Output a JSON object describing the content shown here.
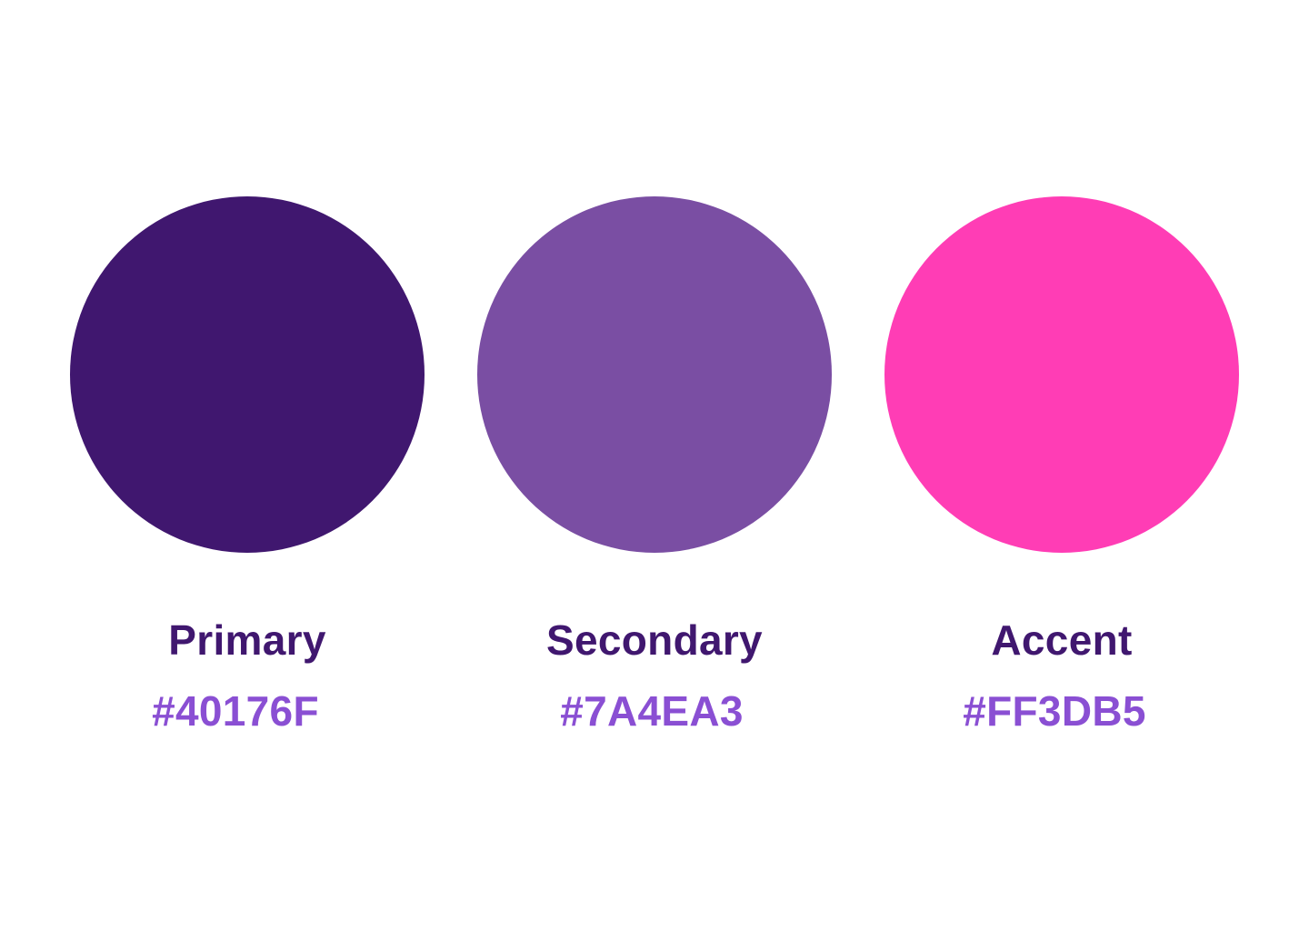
{
  "palette": {
    "swatches": [
      {
        "name": "Primary",
        "hex_label": "#40176F",
        "color": "#40176F"
      },
      {
        "name": "Secondary",
        "hex_label": "#7A4EA3",
        "color": "#7A4EA3"
      },
      {
        "name": "Accent",
        "hex_label": "#FF3DB5",
        "color": "#FF3DB5"
      }
    ],
    "name_text_color": "#40176F",
    "hex_text_color": "#8A4FD3"
  }
}
